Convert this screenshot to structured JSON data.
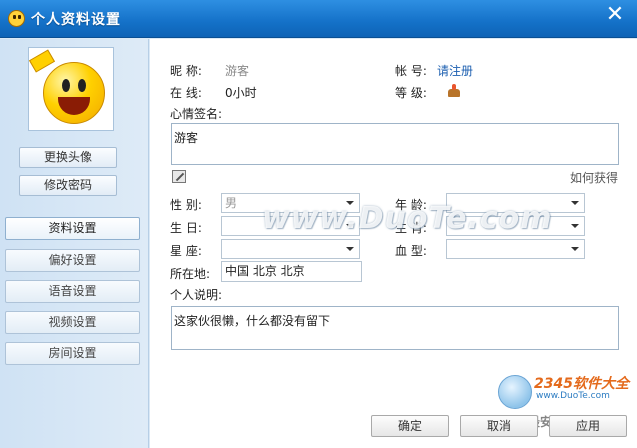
{
  "window": {
    "title": "个人资料设置"
  },
  "sidebar": {
    "change_avatar": "更换头像",
    "change_password": "修改密码",
    "nav": [
      {
        "label": "资料设置",
        "active": true
      },
      {
        "label": "偏好设置",
        "active": false
      },
      {
        "label": "语音设置",
        "active": false
      },
      {
        "label": "视频设置",
        "active": false
      },
      {
        "label": "房间设置",
        "active": false
      }
    ]
  },
  "profile": {
    "nickname_label": "昵    称:",
    "nickname_value": "游客",
    "account_label": "帐    号:",
    "account_value": "请注册",
    "online_label": "在    线:",
    "online_value": "0小时",
    "level_label": "等    级:",
    "level_icon": "cake-level-icon",
    "mood_label": "心情签名:",
    "mood_value": "游客",
    "how_to_get": "如何获得",
    "gender_label": "性    别:",
    "gender_value": "男",
    "age_label": "年    龄:",
    "age_value": "",
    "birthday_label": "生    日:",
    "birthday_value": "",
    "zodiac_label": "生    肖:",
    "zodiac_value": "",
    "constellation_label": "星    座:",
    "constellation_value": "",
    "blood_label": "血    型:",
    "blood_value": "",
    "location_label": "所在地:",
    "location_value": "中国  北京  北京",
    "bio_label": "个人说明:",
    "bio_value": "这家伙很懒，什么都没有留下"
  },
  "footer": {
    "ok": "确定",
    "cancel": "取消",
    "apply": "应用"
  },
  "watermark": {
    "text": "www.DuoTe.com",
    "site_number": "2345软件大全",
    "site_url": "www.DuoTe.com",
    "slogan": "国内最安全的软件站"
  },
  "colors": {
    "titlebar": "#1471c8",
    "link": "#1c5fb0",
    "sidebar_bg": "#d6e6f5"
  }
}
